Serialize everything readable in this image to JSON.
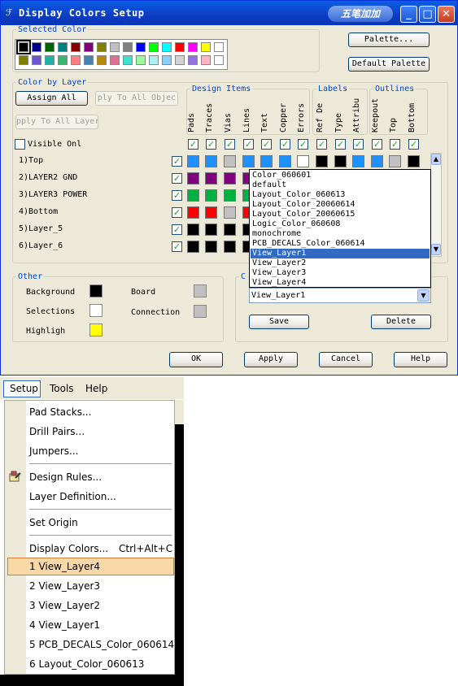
{
  "dialog": {
    "title": "Display Colors Setup",
    "ime_label": "五笔加加",
    "minimize": "_",
    "maximize": "□",
    "close": "✕",
    "selected_color_legend": "Selected Color",
    "palette_colors_row1": [
      "#000000",
      "#00008B",
      "#006400",
      "#008080",
      "#8B0000",
      "#800080",
      "#808000",
      "#C0C0C0",
      "#808080",
      "#0000FF",
      "#00FF00",
      "#00FFFF",
      "#FF0000",
      "#FF00FF",
      "#FFFF00",
      "#FFFFFF"
    ],
    "palette_colors_row2": [
      "#808000",
      "#6A5ACD",
      "#20B2AA",
      "#3CB371",
      "#FF7F7F",
      "#4682B4",
      "#B8860B",
      "#DB7093",
      "#40E0D0",
      "#98FB98",
      "#AFEEEE",
      "#87CEFA",
      "#D3D3D3",
      "#9370DB",
      "#FFB6C1",
      "#FFFFFF"
    ],
    "palette_button": "Palette...",
    "default_palette_button": "Default Palette",
    "color_by_layer_legend": "Color by Layer",
    "assign_all_button": "Assign All",
    "apply_all_objects_button": "ply To All Objec",
    "apply_all_layers_button": "pply To All Layer",
    "visible_only_label": "Visible Onl",
    "design_items_legend": "Design Items",
    "labels_legend": "Labels",
    "outlines_legend": "Outlines",
    "column_headers": [
      "Pads",
      "Traces",
      "Vias",
      "Lines",
      "Text",
      "Copper",
      "Errors",
      "Ref De",
      "Type",
      "Attribu",
      "Keepout",
      "Top",
      "Bottom"
    ],
    "layers": [
      {
        "name": "1)Top",
        "colors": [
          "#1E90FF",
          "#1E90FF",
          "#C0C0C0",
          "#1E90FF",
          "#1E90FF",
          "#1E90FF",
          "#FFFFFF",
          "#000000",
          "#000000",
          "#1E90FF",
          "#1E90FF",
          "#C0C0C0",
          "#000000"
        ]
      },
      {
        "name": "2)LAYER2 GND",
        "colors": [
          "#800080",
          "#800080",
          "#800080",
          "#800080"
        ]
      },
      {
        "name": "3)LAYER3 POWER",
        "colors": [
          "#00B040",
          "#00B040",
          "#00B040",
          "#00B040"
        ]
      },
      {
        "name": "4)Bottom",
        "colors": [
          "#FF0000",
          "#FF0000",
          "#C0C0C0",
          "#FF0000"
        ]
      },
      {
        "name": "5)Layer_5",
        "colors": [
          "#000000",
          "#000000",
          "#000000",
          "#000000"
        ]
      },
      {
        "name": "6)Layer_6",
        "colors": [
          "#000000",
          "#000000",
          "#000000",
          "#000000"
        ]
      }
    ],
    "config_dropdown": {
      "value": "View_Layer1",
      "options": [
        "Color_060601",
        "default",
        "Layout_Color_060613",
        "Layout_Color_20060614",
        "Layout_Color_20060615",
        "Logic_Color_060608",
        "monochrome",
        "PCB_DECALS_Color_060614",
        "View_Layer1",
        "View_Layer2",
        "View_Layer3",
        "View_Layer4"
      ],
      "selected_option": "View_Layer1",
      "legend_fragment": "C"
    },
    "other_legend": "Other",
    "other_items": [
      {
        "label": "Background",
        "color": "#000000"
      },
      {
        "label": "Selections",
        "color": "#FFFFFF"
      },
      {
        "label": "Highligh",
        "color": "#FFFF00"
      },
      {
        "label": "Board",
        "color": "#C0C0C0"
      },
      {
        "label": "Connection",
        "color": "#C0C0C0"
      }
    ],
    "save_button": "Save",
    "delete_button": "Delete",
    "ok_button": "OK",
    "apply_button": "Apply",
    "cancel_button": "Cancel",
    "help_button": "Help"
  },
  "menubar": {
    "items": [
      "Setup",
      "Tools",
      "Help"
    ]
  },
  "setup_menu": {
    "items": [
      {
        "label": "Pad Stacks..."
      },
      {
        "label": "Drill Pairs..."
      },
      {
        "label": "Jumpers..."
      },
      {
        "label": "Design Rules..."
      },
      {
        "label": "Layer Definition..."
      },
      {
        "label": "Set Origin"
      },
      {
        "label": "Display Colors...",
        "shortcut": "Ctrl+Alt+C"
      },
      {
        "label": "1 View_Layer4"
      },
      {
        "label": "2 View_Layer3"
      },
      {
        "label": "3 View_Layer2"
      },
      {
        "label": "4 View_Layer1"
      },
      {
        "label": "5 PCB_DECALS_Color_060614"
      },
      {
        "label": "6 Layout_Color_060613"
      }
    ]
  }
}
